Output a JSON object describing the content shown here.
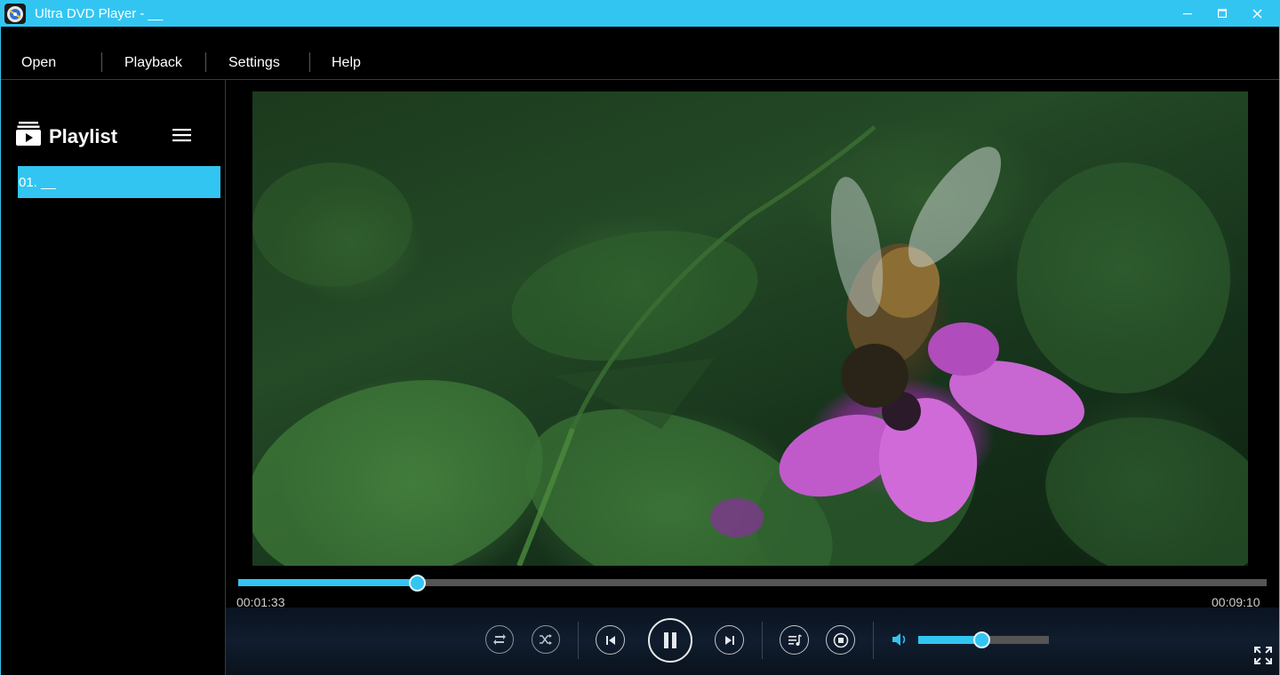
{
  "window": {
    "title": "Ultra DVD Player - __",
    "accent_color": "#33c5f2",
    "controls": [
      "minimize-icon",
      "maximize-icon",
      "close-icon"
    ]
  },
  "menu": {
    "items": [
      {
        "label": "Open"
      },
      {
        "label": "Playback"
      },
      {
        "label": "Settings"
      },
      {
        "label": "Help"
      }
    ]
  },
  "playlist": {
    "title": "Playlist",
    "items": [
      {
        "label": "01. __",
        "selected": true
      }
    ]
  },
  "player": {
    "current_time": "00:01:33",
    "total_time": "00:09:10",
    "progress": 0.1749,
    "volume": 0.49,
    "state": "playing",
    "controls": [
      "repeat-icon",
      "shuffle-icon",
      "previous-icon",
      "pause-icon",
      "next-icon",
      "lyrics-icon",
      "stop-icon",
      "volume-icon",
      "fullscreen-icon"
    ]
  }
}
